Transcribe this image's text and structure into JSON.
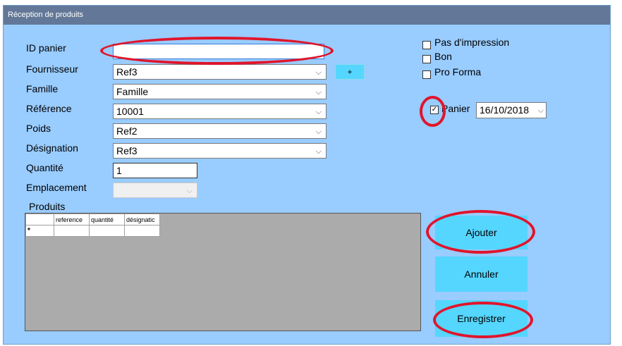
{
  "window": {
    "title": "Réception de produits"
  },
  "form": {
    "id_panier": {
      "label": "ID panier",
      "value": ""
    },
    "fournisseur": {
      "label": "Fournisseur",
      "value": "Ref3"
    },
    "add_button_label": "+",
    "famille": {
      "label": "Famille",
      "value": "Famille"
    },
    "reference": {
      "label": "Référence",
      "value": "10001"
    },
    "poids": {
      "label": "Poids",
      "value": "Ref2"
    },
    "designation": {
      "label": "Désignation",
      "value": "Ref3"
    },
    "quantite": {
      "label": "Quantité",
      "value": "1"
    },
    "emplacement": {
      "label": "Emplacement",
      "value": ""
    }
  },
  "options": [
    {
      "label": "Pas d'impression",
      "checked": false
    },
    {
      "label": "Bon",
      "checked": false
    },
    {
      "label": "Pro Forma",
      "checked": false
    }
  ],
  "panier": {
    "label": "Panier",
    "checked": true,
    "check_glyph": "✓",
    "date": "16/10/2018"
  },
  "products": {
    "title": "Produits",
    "columns": [
      "reference",
      "quantité",
      "désignatic"
    ],
    "new_row_marker": "*"
  },
  "actions": {
    "ajouter": "Ajouter",
    "annuler": "Annuler",
    "enregistrer": "Enregistrer"
  },
  "icons": {
    "dropdown": "chevron-down-icon",
    "dropdown_glyph": "⌵"
  },
  "colors": {
    "window_bg": "#99ccff",
    "titlebar": "#637898",
    "button": "#55d6ff",
    "annotation": "#e0152b"
  }
}
